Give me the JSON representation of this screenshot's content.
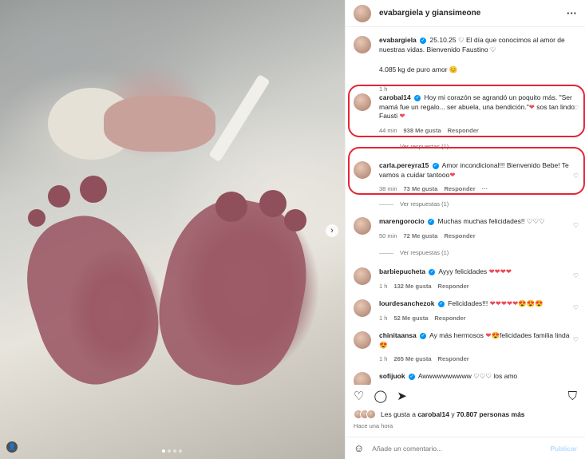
{
  "header": {
    "author": "evabargiela y giansimeone",
    "more": "···"
  },
  "caption": {
    "user": "evabargiela",
    "text": "25.10.25 ♡ El día que conocimos al amor de nuestras vidas. Bienvenido Faustino ♡",
    "text2": "4.085 kg de puro amor 😊",
    "time": "1 h"
  },
  "comments": [
    {
      "user": "carobal14",
      "text": "Hoy mi corazón se agrandó un poquito más. \"Ser mamá fue un regalo... ser abuela, una bendición.\"",
      "heart": "❤",
      "text_end": " sos tan lindo Fausti",
      "heart2": "❤",
      "time": "44 min",
      "likes": "938 Me gusta",
      "reply": "Responder",
      "replies": "Ver respuestas (1)"
    },
    {
      "user": "carla.pereyra15",
      "text": "Amor incondicional!!! Bienvenido Bebe! Te vamos a cuidar tantooo",
      "heart": "❤",
      "time": "38 min",
      "likes": "73 Me gusta",
      "reply": "Responder",
      "dots": "···",
      "replies": "Ver respuestas (1)"
    },
    {
      "user": "marengorocio",
      "text": "Muchas muchas felicidades!! ♡♡♡",
      "time": "50 min",
      "likes": "72 Me gusta",
      "reply": "Responder",
      "replies": "Ver respuestas (1)"
    },
    {
      "user": "barbiepucheta",
      "text": "Ayyy felicidades",
      "hearts": "❤❤❤❤",
      "time": "1 h",
      "likes": "132 Me gusta",
      "reply": "Responder"
    },
    {
      "user": "lourdesanchezok",
      "text": "Felicidades!!!",
      "hearts": "❤❤❤❤❤😍😍😍",
      "time": "1 h",
      "likes": "52 Me gusta",
      "reply": "Responder"
    },
    {
      "user": "chinitaansa",
      "text": "Ay más hermosos",
      "heart": "❤",
      "text_end": "😍felicidades familia linda 😍",
      "time": "1 h",
      "likes": "265 Me gusta",
      "reply": "Responder"
    },
    {
      "user": "sofijuok",
      "text": "Awwwwwwwwww ♡♡♡ los amo"
    }
  ],
  "likes_summary": {
    "prefix": "Les gusta a ",
    "user": "carobal14",
    "mid": " y ",
    "count": "70.807 personas más"
  },
  "post_time": "Hace una hora",
  "add_comment": {
    "placeholder": "Añade un comentario...",
    "post_label": "Publicar"
  },
  "icons": {
    "like": "heart-icon",
    "comment": "comment-icon",
    "share": "share-icon",
    "save": "bookmark-icon",
    "emoji": "emoji-icon"
  },
  "colors": {
    "highlight": "#e32636",
    "verified": "#0095f6",
    "heart": "#ed4956"
  }
}
